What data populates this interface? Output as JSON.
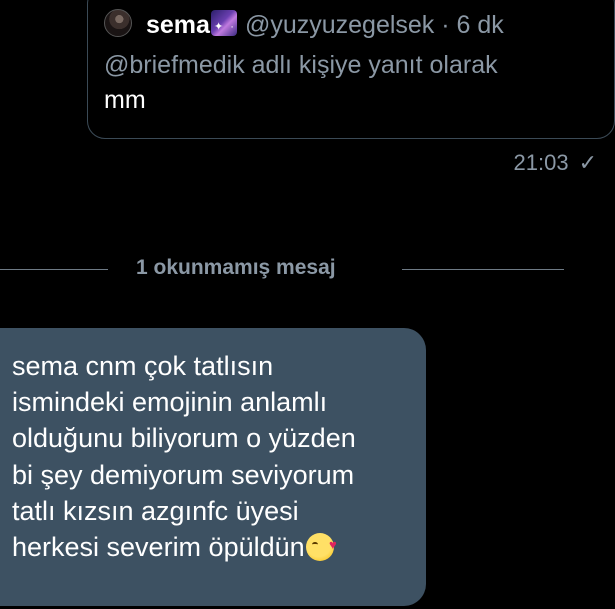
{
  "quoted_tweet": {
    "author_name": "sema",
    "author_emoji": "galaxy-emoji",
    "author_meta": "@yuzyuzegelsek · 6 dk",
    "reply_to": "@briefmedik adlı kişiye yanıt olarak",
    "text": "mm"
  },
  "sent_time": "21:03",
  "sent_status_icon": "✓",
  "unread_divider": "1 okunmamış mesaj",
  "incoming_message": {
    "text": "sema cnm çok tatlısın\nismindeki emojinin anlamlı\nolduğunu biliyorum o yüzden\nbi şey demiyorum seviyorum\ntatlı kızsın azgınfc üyesi\nherkesi severim öpüldün",
    "trailing_emoji": "kissing-face-emoji"
  },
  "colors": {
    "background": "#000000",
    "incoming_bubble": "#3d5162",
    "secondary_text": "#8b98a5",
    "card_border": "#3b4a56"
  }
}
